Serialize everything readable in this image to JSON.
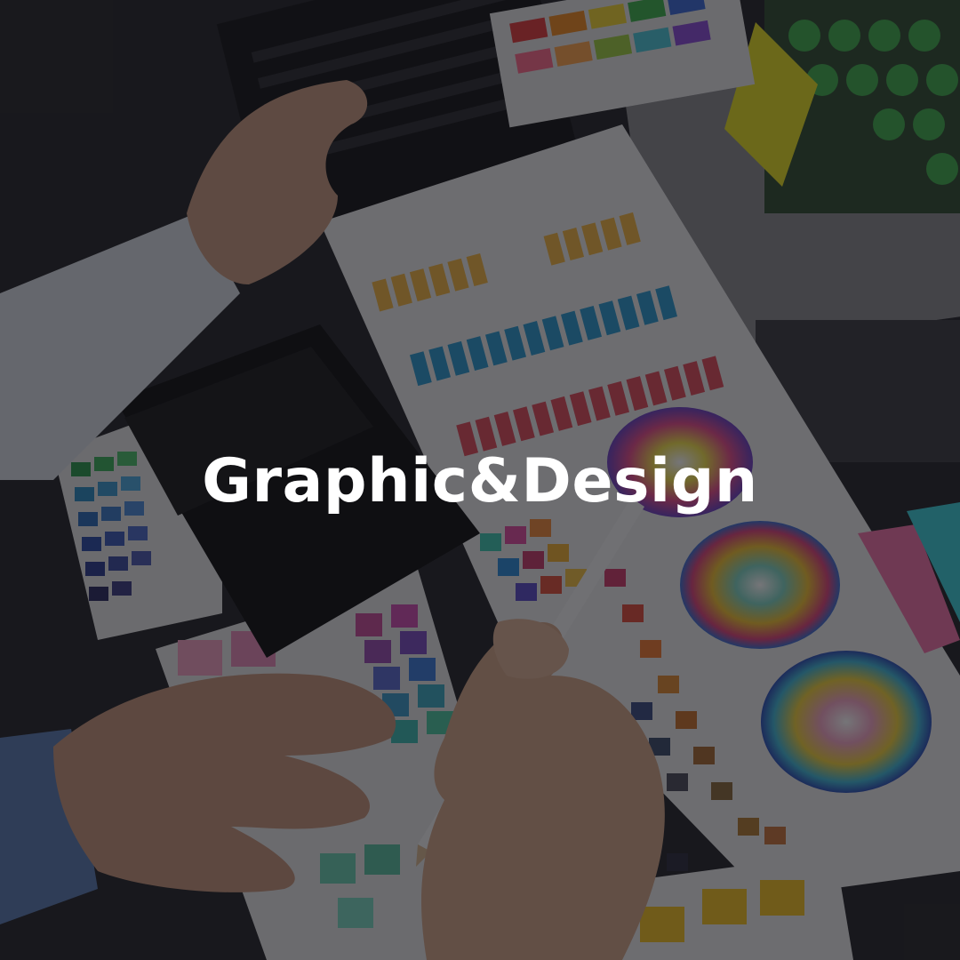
{
  "title": "Graphic&Design",
  "colors": {
    "overlay": "#121216",
    "title_text": "#ffffff",
    "desk": "#1c1c1e"
  }
}
